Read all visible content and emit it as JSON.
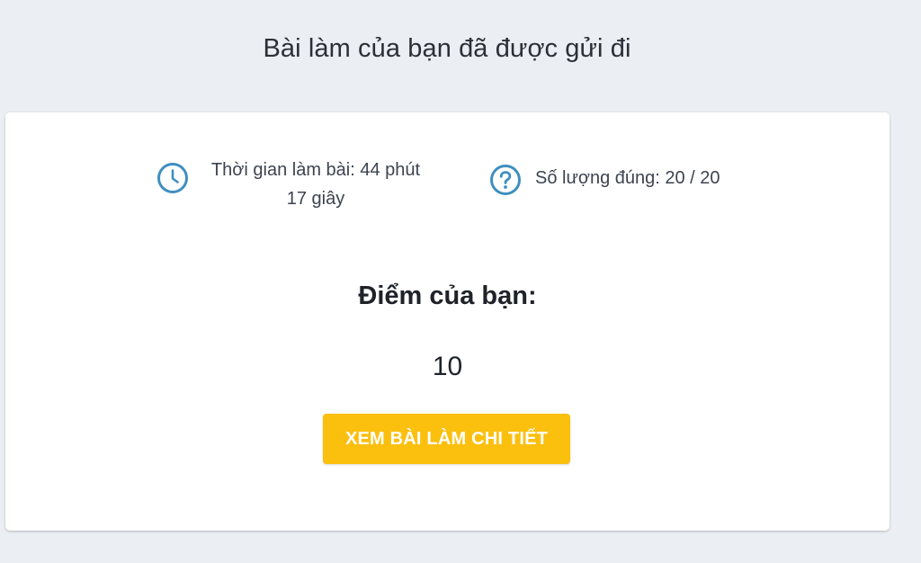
{
  "header": {
    "title": "Bài làm của bạn đã được gửi đi"
  },
  "stats": {
    "time": {
      "icon": "clock-icon",
      "line1": "Thời gian làm bài: 44 phút",
      "line2": "17 giây"
    },
    "correct": {
      "icon": "question-circle-icon",
      "label": "Số lượng đúng: 20 / 20"
    }
  },
  "score": {
    "label": "Điểm của bạn:",
    "value": "10"
  },
  "actions": {
    "detail_label": "XEM BÀI LÀM CHI TIẾT"
  },
  "colors": {
    "page_background": "#ebeef3",
    "card_background": "#ffffff",
    "icon": "#3f8fbf",
    "accent_button": "#fbbf0e"
  }
}
